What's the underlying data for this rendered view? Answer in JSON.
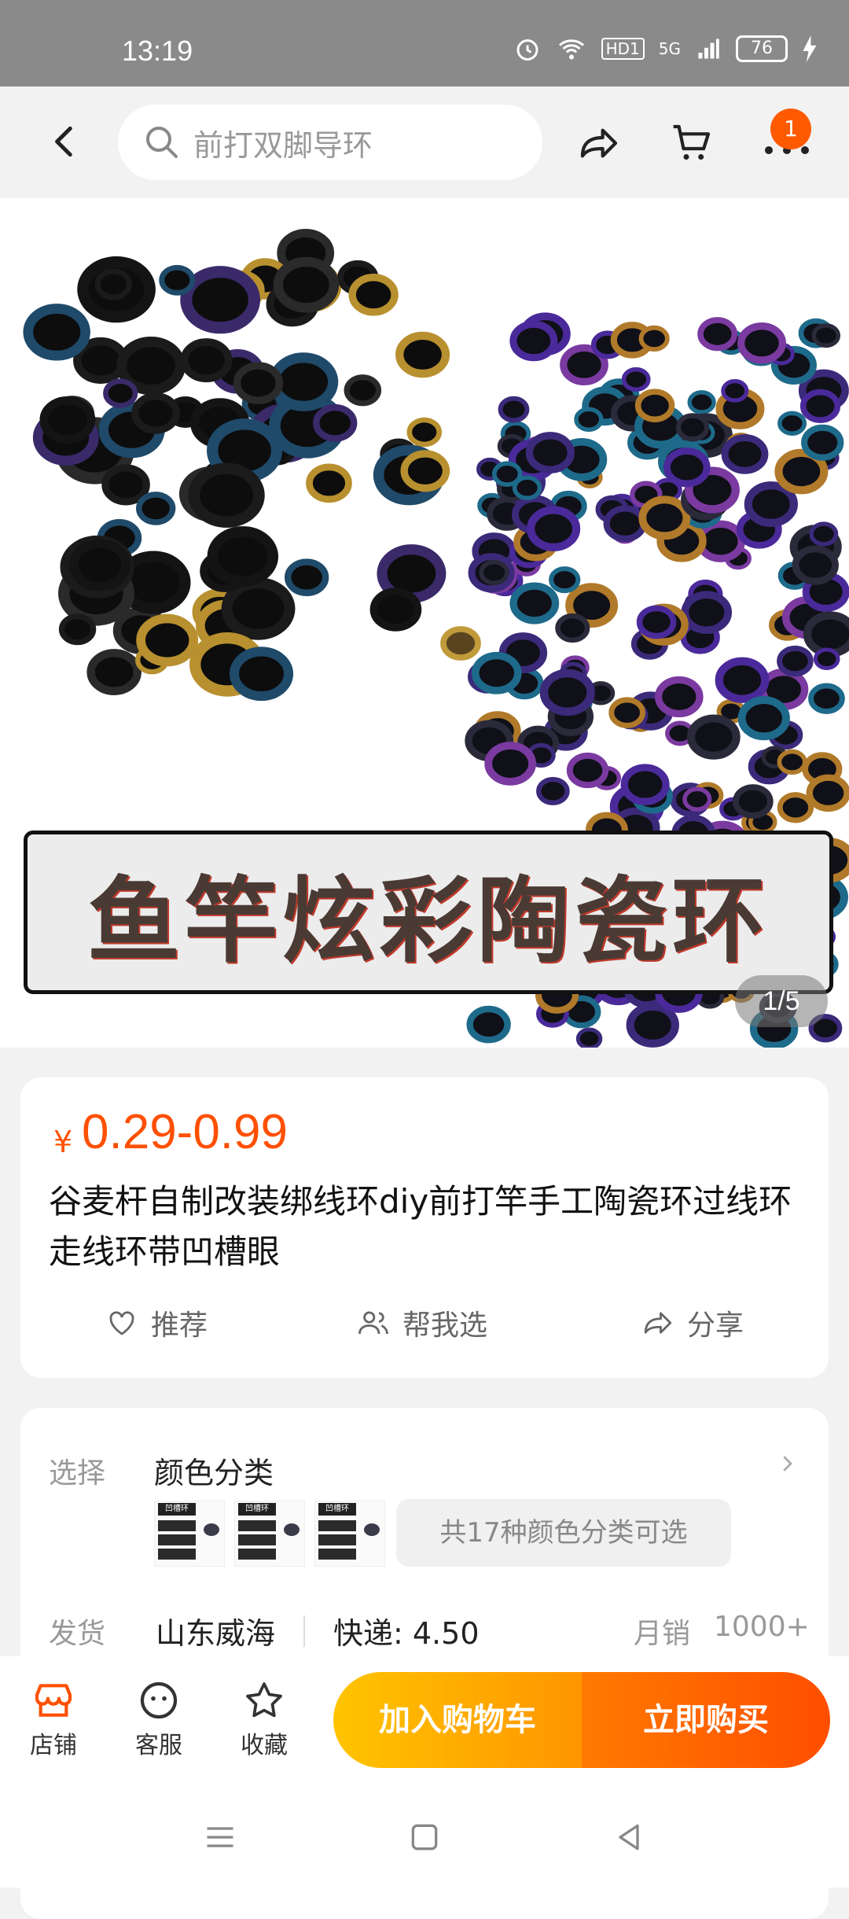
{
  "status_bar": {
    "time": "13:19",
    "battery": "76",
    "network": "5G",
    "hd": "HD1"
  },
  "nav": {
    "search_placeholder": "前打双脚导环",
    "cart_badge": "1"
  },
  "gallery": {
    "banner_text": "鱼竿炫彩陶瓷环",
    "counter": "1/5"
  },
  "product": {
    "currency": "¥",
    "price": "0.29-0.99",
    "title": "谷麦杆自制改装绑线环diy前打竿手工陶瓷环过线环走线环带凹槽眼",
    "actions": {
      "recommend": "推荐",
      "help_choose": "帮我选",
      "share": "分享"
    }
  },
  "specs": {
    "select_label": "选择",
    "select_value": "颜色分类",
    "thumb_title": "凹槽环",
    "color_options": "共17种颜色分类可选",
    "ship_label": "发货",
    "ship_from": "山东威海",
    "delivery": "快递: 4.50",
    "monthly_sales_label": "月销",
    "monthly_sales": "1000+"
  },
  "bottom_bar": {
    "shop": "店铺",
    "service": "客服",
    "favorite": "收藏",
    "add_to_cart": "加入购物车",
    "buy_now": "立即购买"
  },
  "colors": {
    "accent": "#ff5000",
    "cart_gradient_start": "#ffc400",
    "buy_gradient_end": "#ff4e00"
  }
}
